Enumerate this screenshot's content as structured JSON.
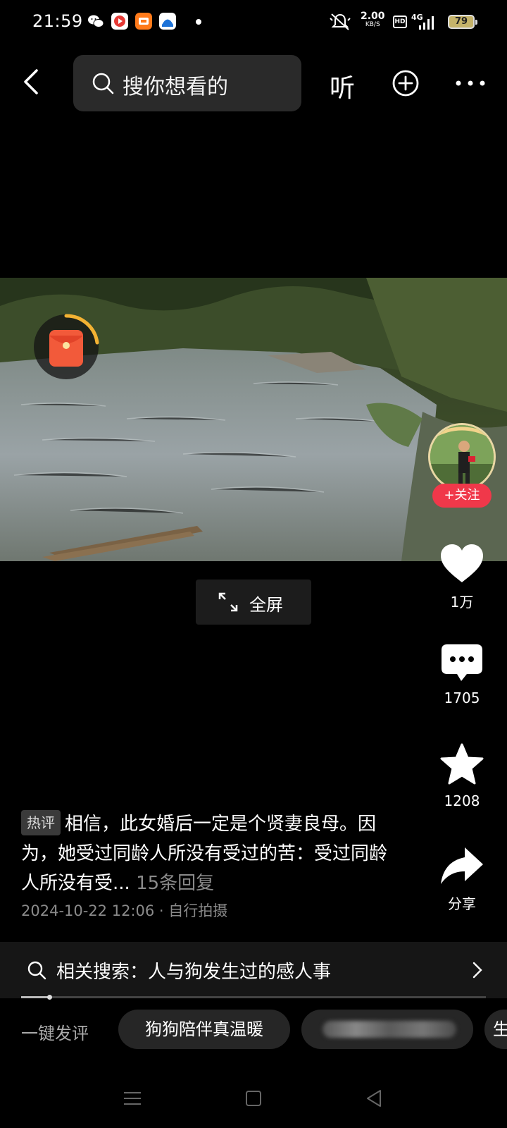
{
  "status_bar": {
    "time": "21:59",
    "net_speed_value": "2.00",
    "net_speed_unit": "KB/S",
    "hd_badge": "HD",
    "signal": "4G",
    "battery": "79"
  },
  "header": {
    "search_placeholder": "搜你想看的",
    "listen_label": "听"
  },
  "video": {
    "follow_label": "+关注",
    "fullscreen_label": "全屏"
  },
  "actions": {
    "like_count": "1万",
    "comment_count": "1705",
    "favorite_count": "1208",
    "share_label": "分享"
  },
  "hot_comment": {
    "tag": "热评",
    "text": "相信，此女婚后一定是个贤妻良母。因为，她受过同龄人所没有受过的苦：受过同龄人所没有受...",
    "replies": "15条回复",
    "meta": "2024-10-22 12:06 · 自行拍摄"
  },
  "related_search": {
    "text": "相关搜索：人与狗发生过的感人事"
  },
  "playback": {
    "progress_fraction": 0.06
  },
  "quick_comment": {
    "label": "一键发评",
    "chips": [
      "狗狗陪伴真温暖",
      "",
      "生"
    ]
  },
  "colors": {
    "background": "#000000",
    "follow_button": "#f0384a",
    "like_icon": "#ffffff"
  }
}
